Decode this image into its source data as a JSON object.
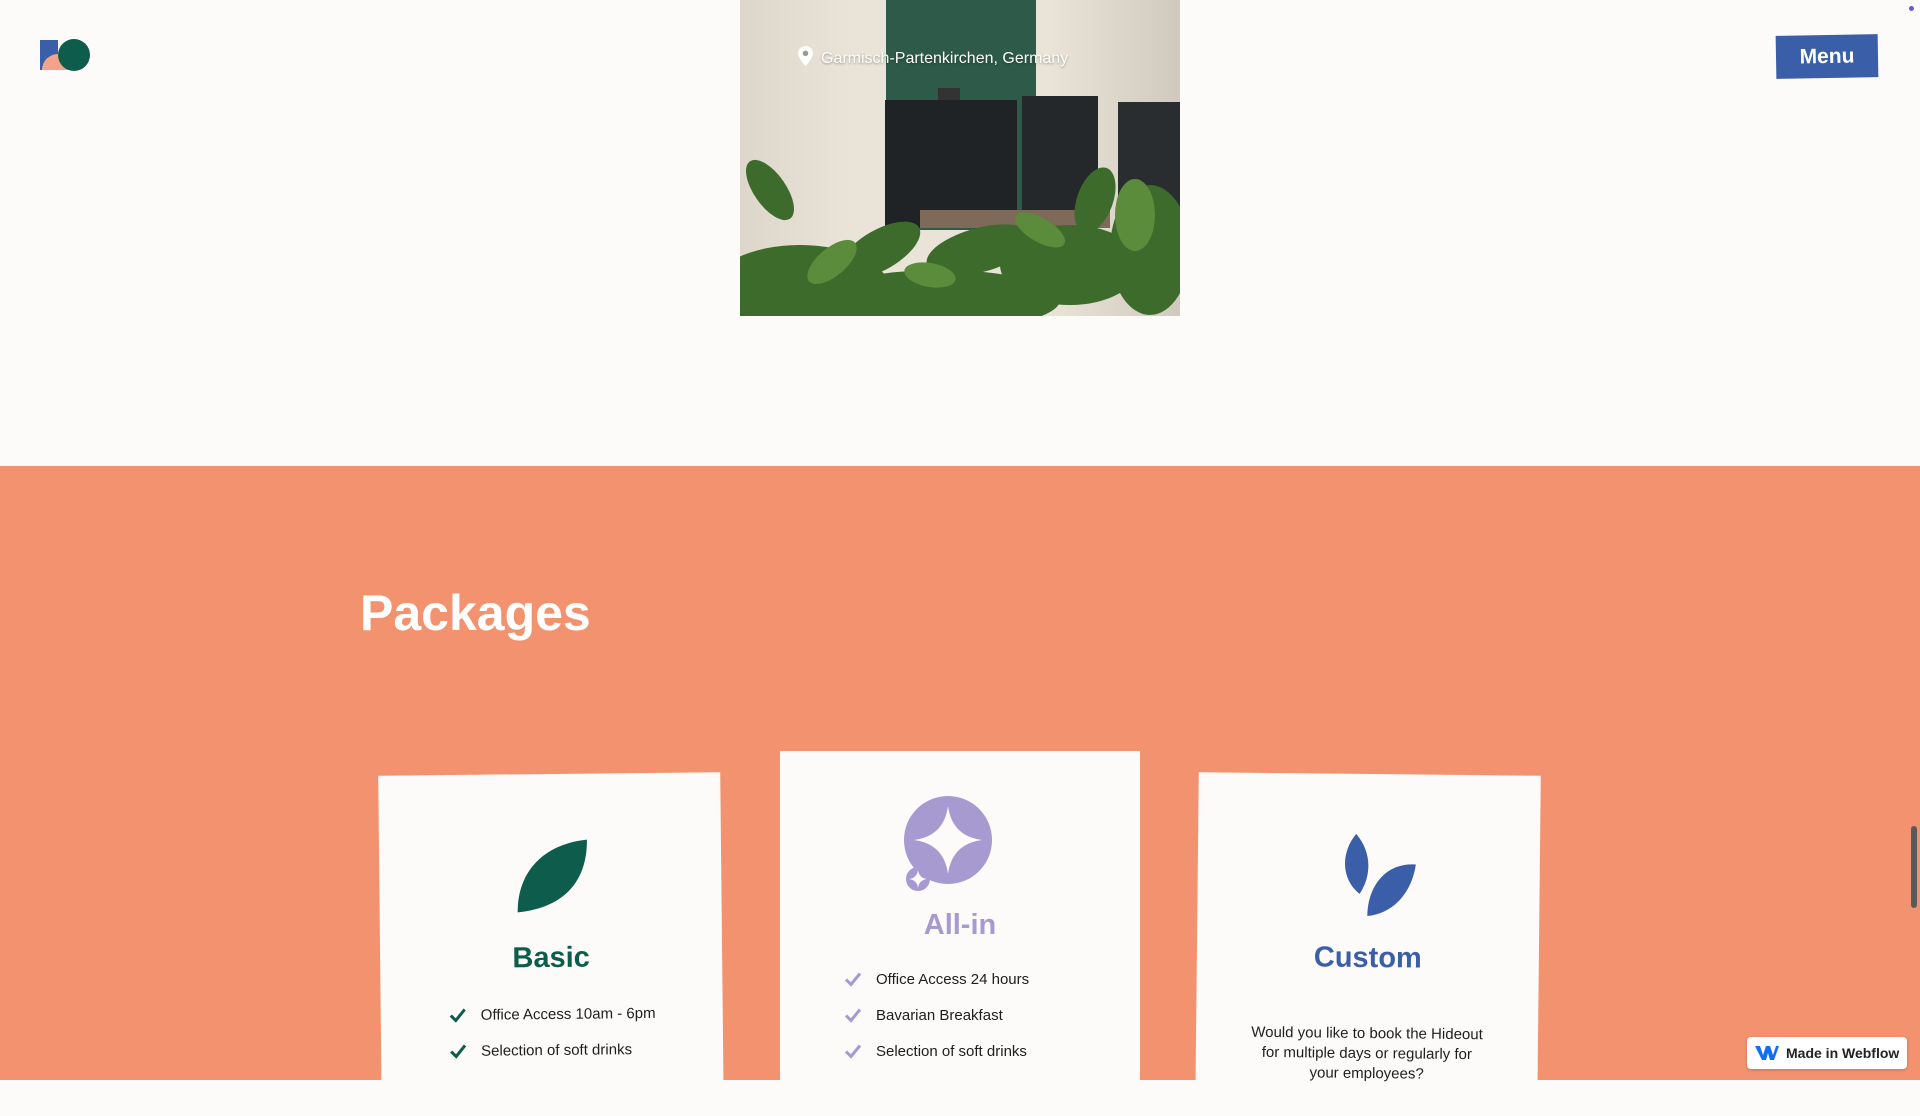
{
  "header": {
    "logo": "studio-logo",
    "menu_label": "Menu"
  },
  "hero": {
    "location": "Garmisch-Partenkirchen, Germany",
    "location_icon": "map-pin-icon"
  },
  "packages": {
    "title": "Packages",
    "cards": [
      {
        "name": "Basic",
        "icon": "leaf-icon",
        "color": "#0e5d4c",
        "features": [
          "Office Access 10am - 6pm",
          "Selection of soft drinks"
        ]
      },
      {
        "name": "All-in",
        "icon": "sparkle-icon",
        "color": "#a79ad1",
        "features": [
          "Office Access 24 hours",
          "Bavarian Breakfast",
          "Selection of soft drinks"
        ]
      },
      {
        "name": "Custom",
        "icon": "sprout-icon",
        "color": "#3a5fa8",
        "description": "Would you like to book the Hideout for multiple days or regularly for your employees?"
      }
    ]
  },
  "badge": {
    "label": "Made in Webflow",
    "icon": "webflow-icon"
  },
  "colors": {
    "background": "#fdfbf9",
    "packages_bg": "#f3926f",
    "accent_blue": "#3a5fa8",
    "accent_green": "#0e5d4c",
    "accent_lavender": "#a79ad1"
  }
}
